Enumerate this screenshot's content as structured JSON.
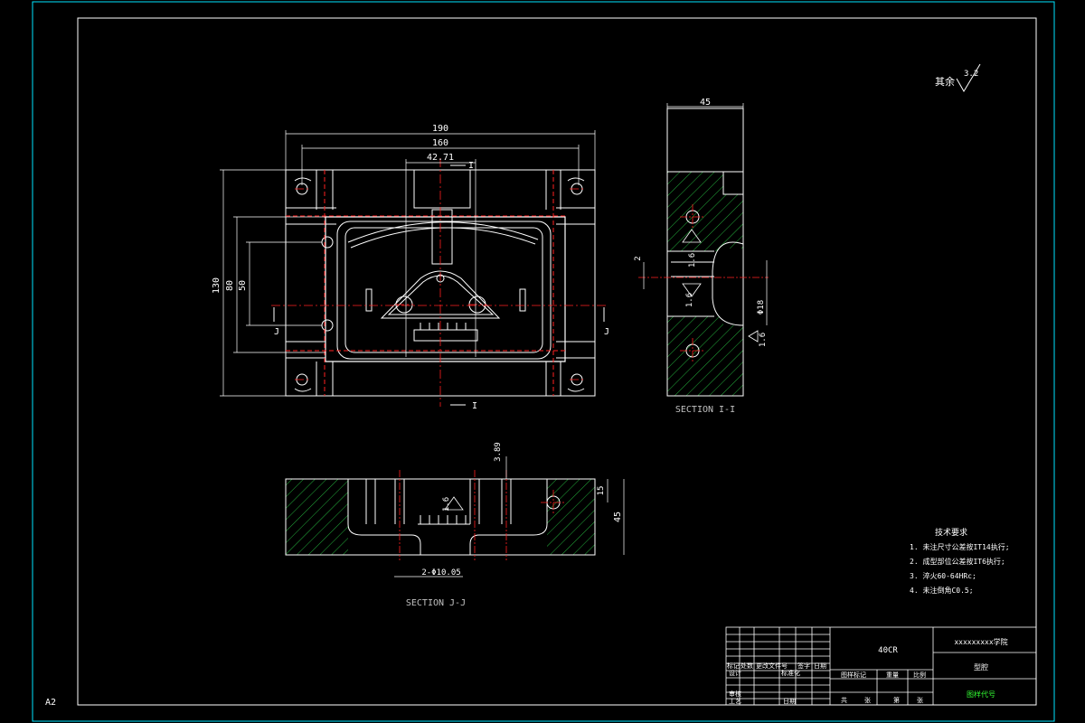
{
  "colors": {
    "background": "#000000",
    "frame": "#00e5ff",
    "line": "#ffffff",
    "center": "#ff2020",
    "hatch": "#2bd94a",
    "hidden": "#808080",
    "green_text": "#33ff33"
  },
  "dims": {
    "d190": "190",
    "d160": "160",
    "d4271": "42.71",
    "d130": "130",
    "d80": "80",
    "d50": "50",
    "side45": "45",
    "side2": "2",
    "rough16a": "1.6",
    "rough16b": "1.6",
    "rough16c": "1.6",
    "dia18": "Φ18",
    "d389": "3.89",
    "d15": "15",
    "d45b": "45",
    "holes": "2-Φ10.05",
    "rough16d": "1.6"
  },
  "labels": {
    "cut_i_top": "I",
    "cut_i_bottom": "I",
    "cut_j_left": "J",
    "cut_j_right": "J",
    "section_ii": "SECTION I-I",
    "section_jj": "SECTION J-J",
    "sheet_size": "A2"
  },
  "roughness": {
    "prefix": "其余",
    "value": "3.2"
  },
  "tech_requirements": {
    "title": "技术要求",
    "items": [
      "1. 未注尺寸公差按IT14执行;",
      "2. 成型部位公差按IT6执行;",
      "3. 淬火60-64HRc;",
      "4. 未注倒角C0.5;"
    ]
  },
  "title_block": {
    "material": "40CR",
    "school": "xxxxxxxxx学院",
    "drawing_name": "型腔",
    "drawing_no": "图样代号",
    "row_mark": [
      "标记",
      "处数",
      "更改文件号",
      "签字",
      "日期"
    ],
    "design": "设计",
    "standardize": "标准化",
    "stage_mark": "图样标记",
    "weight": "重量",
    "scale": "比例",
    "review": "审核",
    "process": "工艺",
    "date": "日期",
    "total": "共",
    "sheet": "张",
    "sheet_no": "第",
    "page": "张"
  }
}
